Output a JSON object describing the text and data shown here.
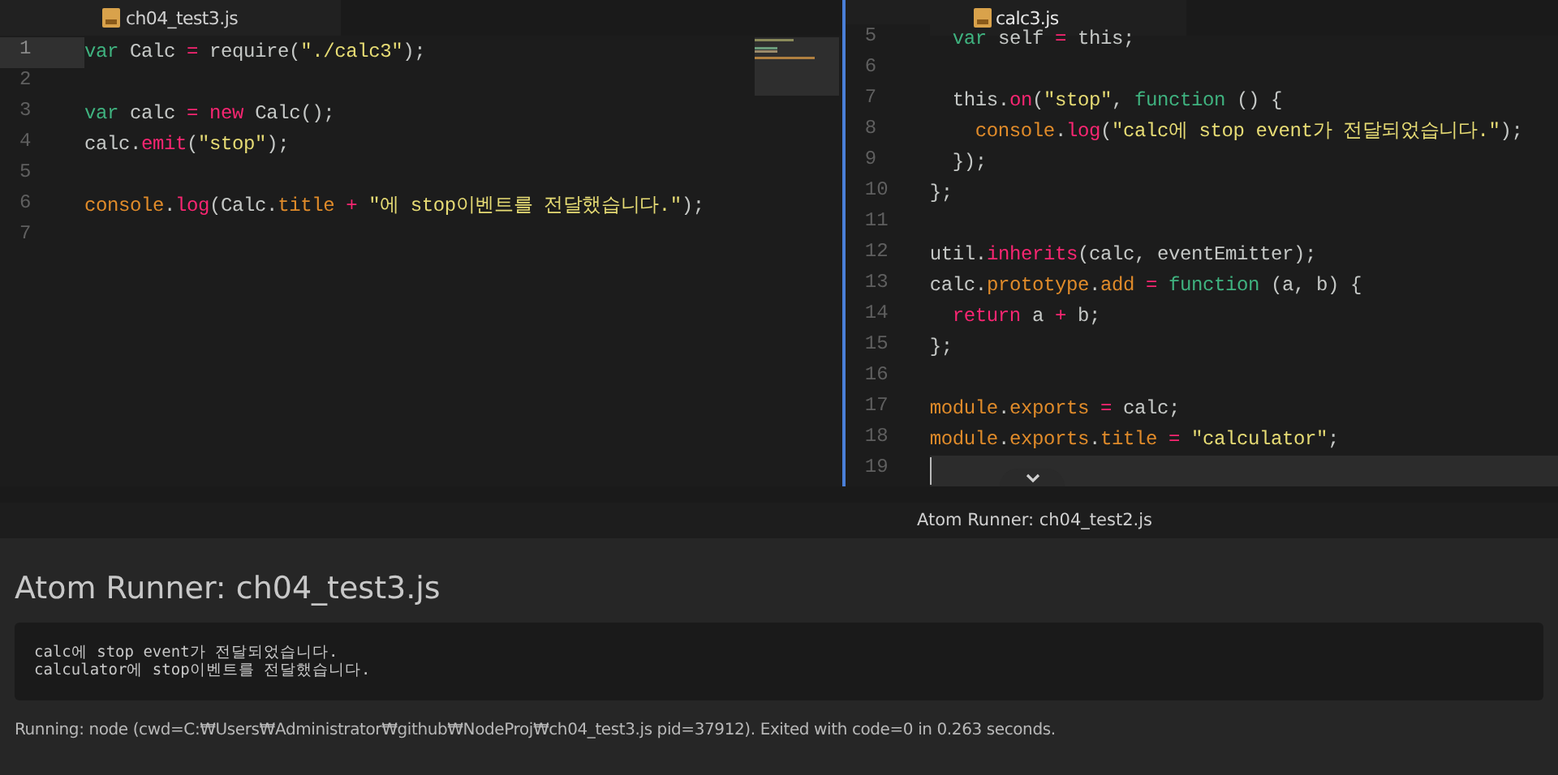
{
  "panes": [
    {
      "tab": {
        "label": "ch04_test3.js",
        "selected": false
      },
      "lines": [
        {
          "number": "1",
          "current": true,
          "tokens": [
            {
              "kind": "kw",
              "text": "var"
            },
            {
              "kind": "txt",
              "text": " Calc "
            },
            {
              "kind": "key",
              "text": "="
            },
            {
              "kind": "txt",
              "text": " require("
            },
            {
              "kind": "str",
              "text": "\"./calc3\""
            },
            {
              "kind": "txt",
              "text": ");"
            }
          ]
        },
        {
          "number": "2",
          "current": false
        },
        {
          "number": "3",
          "current": false,
          "tokens": [
            {
              "kind": "kw",
              "text": "var"
            },
            {
              "kind": "txt",
              "text": " calc "
            },
            {
              "kind": "key",
              "text": "= "
            },
            {
              "kind": "key",
              "text": "new"
            },
            {
              "kind": "txt",
              "text": " Calc();"
            }
          ]
        },
        {
          "number": "4",
          "current": false,
          "tokens": [
            {
              "kind": "txt",
              "text": "calc."
            },
            {
              "kind": "key",
              "text": "emit"
            },
            {
              "kind": "txt",
              "text": "("
            },
            {
              "kind": "str",
              "text": "\"stop\""
            },
            {
              "kind": "txt",
              "text": ");"
            }
          ]
        },
        {
          "number": "5",
          "current": false
        },
        {
          "number": "6",
          "current": false,
          "tokens": [
            {
              "kind": "obj",
              "text": "console"
            },
            {
              "kind": "txt",
              "text": "."
            },
            {
              "kind": "key",
              "text": "log"
            },
            {
              "kind": "txt",
              "text": "(Calc."
            },
            {
              "kind": "obj",
              "text": "title"
            },
            {
              "kind": "key",
              "text": " + "
            },
            {
              "kind": "str",
              "text": "\"에 stop이벤트를 전달했습니다.\""
            },
            {
              "kind": "txt",
              "text": ");"
            }
          ]
        },
        {
          "number": "7",
          "current": false
        }
      ]
    },
    {
      "tab": {
        "label": "calc3.js",
        "selected": true
      },
      "lines": [
        {
          "number": "5",
          "current": false,
          "tokens": [
            {
              "kind": "kw",
              "text": "  var"
            },
            {
              "kind": "txt",
              "text": " self "
            },
            {
              "kind": "key",
              "text": "="
            },
            {
              "kind": "txt",
              "text": " this;"
            }
          ]
        },
        {
          "number": "6",
          "current": false
        },
        {
          "number": "7",
          "current": false,
          "tokens": [
            {
              "kind": "txt",
              "text": "  this."
            },
            {
              "kind": "key",
              "text": "on"
            },
            {
              "kind": "txt",
              "text": "("
            },
            {
              "kind": "str",
              "text": "\"stop\""
            },
            {
              "kind": "txt",
              "text": ", "
            },
            {
              "kind": "kw",
              "text": "function"
            },
            {
              "kind": "txt",
              "text": " () {"
            }
          ]
        },
        {
          "number": "8",
          "current": false,
          "tokens": [
            {
              "kind": "obj",
              "text": "    console"
            },
            {
              "kind": "txt",
              "text": "."
            },
            {
              "kind": "key",
              "text": "log"
            },
            {
              "kind": "txt",
              "text": "("
            },
            {
              "kind": "str",
              "text": "\"calc에 stop event가 전달되었습니다.\""
            },
            {
              "kind": "txt",
              "text": ");"
            }
          ]
        },
        {
          "number": "9",
          "current": false,
          "tokens": [
            {
              "kind": "txt",
              "text": "  });"
            }
          ]
        },
        {
          "number": "10",
          "current": false,
          "tokens": [
            {
              "kind": "txt",
              "text": "};"
            }
          ]
        },
        {
          "number": "11",
          "current": false
        },
        {
          "number": "12",
          "current": false,
          "tokens": [
            {
              "kind": "txt",
              "text": "util."
            },
            {
              "kind": "key",
              "text": "inherits"
            },
            {
              "kind": "txt",
              "text": "(calc, eventEmitter);"
            }
          ]
        },
        {
          "number": "13",
          "current": false,
          "tokens": [
            {
              "kind": "txt",
              "text": "calc."
            },
            {
              "kind": "obj",
              "text": "prototype"
            },
            {
              "kind": "txt",
              "text": "."
            },
            {
              "kind": "obj",
              "text": "add"
            },
            {
              "kind": "key",
              "text": " = "
            },
            {
              "kind": "kw",
              "text": "function"
            },
            {
              "kind": "txt",
              "text": " (a, b) {"
            }
          ]
        },
        {
          "number": "14",
          "current": false,
          "tokens": [
            {
              "kind": "key",
              "text": "  return"
            },
            {
              "kind": "txt",
              "text": " a "
            },
            {
              "kind": "key",
              "text": "+"
            },
            {
              "kind": "txt",
              "text": " b;"
            }
          ]
        },
        {
          "number": "15",
          "current": false,
          "tokens": [
            {
              "kind": "txt",
              "text": "};"
            }
          ]
        },
        {
          "number": "16",
          "current": false
        },
        {
          "number": "17",
          "current": false,
          "tokens": [
            {
              "kind": "obj",
              "text": "module"
            },
            {
              "kind": "txt",
              "text": "."
            },
            {
              "kind": "obj",
              "text": "exports"
            },
            {
              "kind": "key",
              "text": " = "
            },
            {
              "kind": "txt",
              "text": "calc;"
            }
          ]
        },
        {
          "number": "18",
          "current": false,
          "tokens": [
            {
              "kind": "obj",
              "text": "module"
            },
            {
              "kind": "txt",
              "text": "."
            },
            {
              "kind": "obj",
              "text": "exports"
            },
            {
              "kind": "txt",
              "text": "."
            },
            {
              "kind": "obj",
              "text": "title"
            },
            {
              "kind": "key",
              "text": " = "
            },
            {
              "kind": "str",
              "text": "\"calculator\""
            },
            {
              "kind": "txt",
              "text": ";"
            }
          ]
        },
        {
          "number": "19",
          "current": true
        }
      ]
    }
  ],
  "runner": {
    "expanded": true,
    "bar_title": "Atom Runner: ch04_test2.js",
    "title": "Atom Runner: ch04_test3.js",
    "output": [
      "calc에 stop event가 전달되었습니다.",
      "calculator에 stop이벤트를 전달했습니다."
    ],
    "status": "Running: node (cwd=C:₩Users₩Administrator₩github₩NodeProj₩ch04_test3.js pid=37912). Exited with code=0 in 0.263 seconds."
  }
}
